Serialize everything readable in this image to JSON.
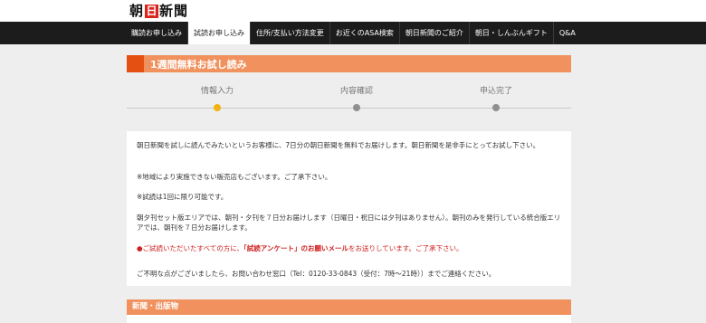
{
  "header": {
    "logo_pre": "朝",
    "logo_sun": "日",
    "logo_post": "新聞"
  },
  "nav": {
    "items": [
      {
        "label": "購読お申し込み"
      },
      {
        "label": "試読お申し込み"
      },
      {
        "label": "住所/支払い方法変更"
      },
      {
        "label": "お近くのASA検索"
      },
      {
        "label": "朝日新聞のご紹介"
      },
      {
        "label": "朝日・しんぶんギフト"
      },
      {
        "label": "Q&A"
      }
    ]
  },
  "page": {
    "title": "1週間無料お試し読み"
  },
  "steps": [
    {
      "label": "情報入力",
      "state": "current"
    },
    {
      "label": "内容確認",
      "state": "pending"
    },
    {
      "label": "申込完了",
      "state": "pending"
    }
  ],
  "content": {
    "p1": "朝日新聞を試しに読んでみたいというお客様に、7日分の朝日新聞を無料でお届けします。朝日新聞を是非手にとってお試し下さい。",
    "p2": "※地域により実施できない販売店もございます。ご了承下さい。",
    "p3": "※試読は1回に限り可能です。",
    "p4": "朝夕刊セット版エリアでは、朝刊・夕刊を７日分お届けします（日曜日・祝日には夕刊はありません）。朝刊のみを発行している統合版エリアでは、朝刊を７日分お届けします。",
    "p5_pre": "●ご試読いただいたすべての方に、",
    "p5_bold": "「試読アンケート」のお願いメール",
    "p5_post": "をお送りしています。ご了承下さい。",
    "p6": "ご不明な点がございましたら、お問い合わせ窓口（Tel：0120-33-0843（受付：7時～21時））までご連絡ください。"
  },
  "section": {
    "title": "新聞・出版物"
  },
  "colors": {
    "accent_orange": "#f0915e",
    "accent_dark": "#e44f12",
    "nav_bg": "#1c1c1c",
    "current_step": "#f2b211",
    "notice_red": "#d21e1e"
  }
}
